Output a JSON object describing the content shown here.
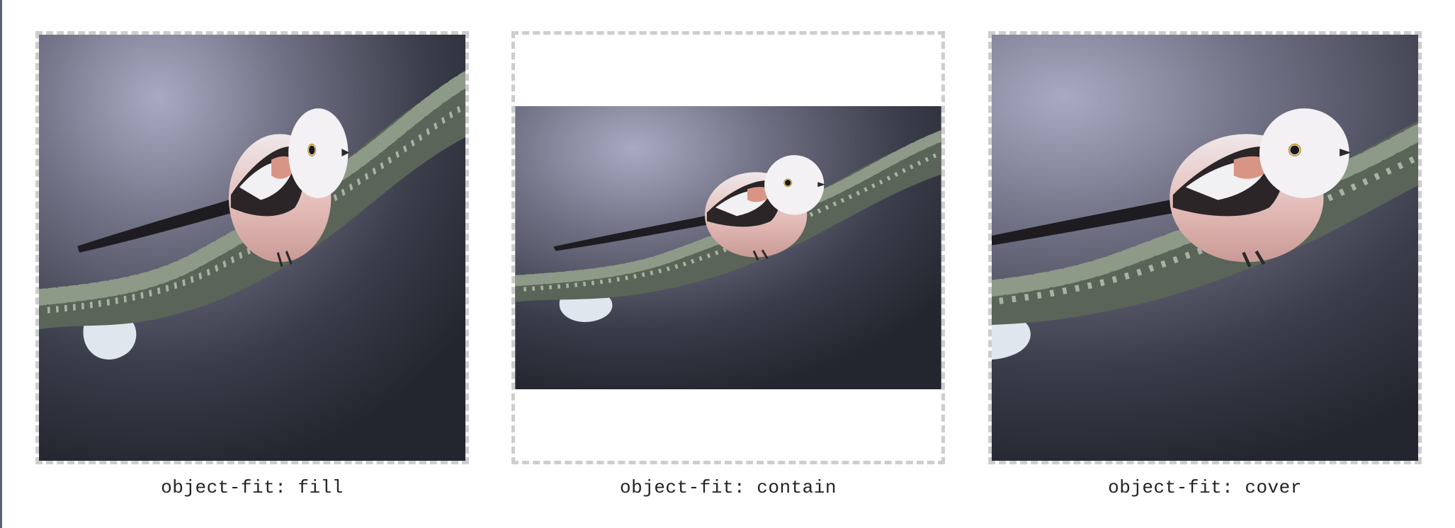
{
  "panels": [
    {
      "id": "fill",
      "caption": "object-fit: fill"
    },
    {
      "id": "contain",
      "caption": "object-fit: contain"
    },
    {
      "id": "cover",
      "caption": "object-fit: cover"
    }
  ],
  "photo": {
    "subject": "long-tailed-tit-on-lichen-branch"
  },
  "colors": {
    "frame_border": "#cdcdcd",
    "caption_text": "#222222",
    "photo_background_top": "#a6a6bf",
    "photo_background_bottom": "#262a33"
  }
}
